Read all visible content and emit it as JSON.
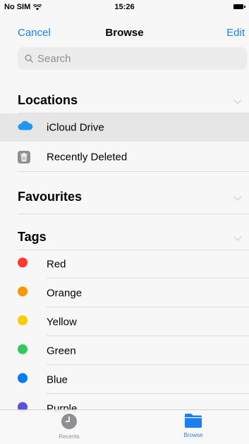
{
  "status_bar": {
    "carrier": "No SIM",
    "time": "15:26"
  },
  "nav": {
    "left": "Cancel",
    "title": "Browse",
    "right": "Edit"
  },
  "search": {
    "placeholder": "Search"
  },
  "sections": {
    "locations": {
      "title": "Locations",
      "items": [
        {
          "label": "iCloud Drive",
          "icon": "cloud-icon",
          "selected": true
        },
        {
          "label": "Recently Deleted",
          "icon": "trash-icon",
          "selected": false
        }
      ]
    },
    "favourites": {
      "title": "Favourites"
    },
    "tags": {
      "title": "Tags",
      "items": [
        {
          "label": "Red",
          "color": "#ff3b30"
        },
        {
          "label": "Orange",
          "color": "#ff9500"
        },
        {
          "label": "Yellow",
          "color": "#ffcc00"
        },
        {
          "label": "Green",
          "color": "#34c759"
        },
        {
          "label": "Blue",
          "color": "#007aff"
        },
        {
          "label": "Purple",
          "color": "#5856d6"
        }
      ]
    }
  },
  "tabs": [
    {
      "label": "Recents",
      "icon": "clock-icon",
      "active": false
    },
    {
      "label": "Browse",
      "icon": "folder-icon",
      "active": true
    }
  ],
  "colors": {
    "accent": "#1a7ff0",
    "inactive": "#8e8e93"
  }
}
